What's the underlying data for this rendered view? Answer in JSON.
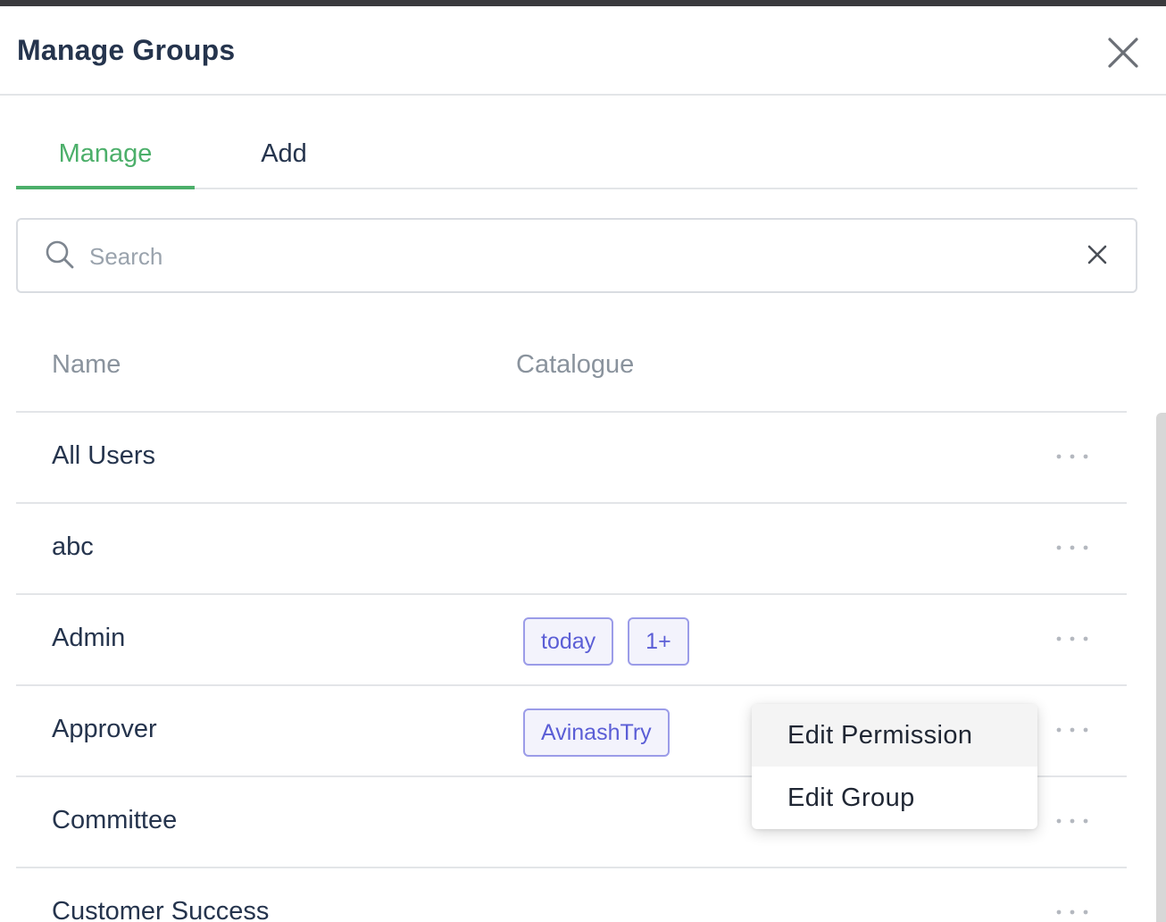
{
  "modal": {
    "title": "Manage Groups"
  },
  "tabs": [
    {
      "label": "Manage",
      "active": true
    },
    {
      "label": "Add",
      "active": false
    }
  ],
  "search": {
    "placeholder": "Search",
    "value": ""
  },
  "table": {
    "columns": [
      "Name",
      "Catalogue"
    ],
    "rows": [
      {
        "name": "All Users",
        "catalogue": []
      },
      {
        "name": "abc",
        "catalogue": []
      },
      {
        "name": "Admin",
        "catalogue": [
          "today",
          "1+"
        ]
      },
      {
        "name": "Approver",
        "catalogue": [
          "AvinashTry"
        ]
      },
      {
        "name": "Committee",
        "catalogue": []
      },
      {
        "name": "Customer Success",
        "catalogue": []
      }
    ]
  },
  "context_menu": {
    "items": [
      "Edit Permission",
      "Edit Group"
    ]
  },
  "colors": {
    "accent": "#4caf6a",
    "chip_text": "#5b5ed6",
    "chip_border": "#9b9ce8",
    "title": "#25344d"
  },
  "icons": {
    "close": "close-icon",
    "search": "search-icon",
    "clear": "clear-icon",
    "more": "more-horizontal-icon"
  }
}
